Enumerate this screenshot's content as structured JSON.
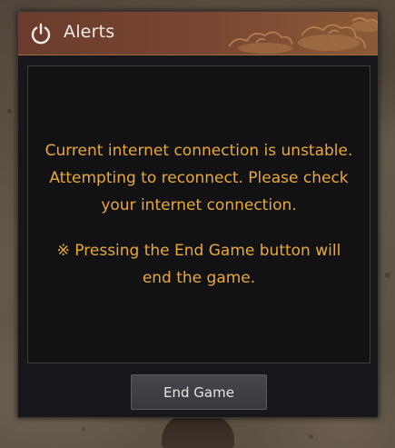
{
  "dialog": {
    "title": "Alerts",
    "title_icon": "power-icon",
    "message_lines": [
      "Current internet connection is unstable.",
      "Attempting to reconnect. Please check",
      "your internet connection."
    ],
    "note_lines": [
      "※ Pressing the End Game button will",
      "end the game."
    ],
    "end_button_label": "End Game"
  },
  "colors": {
    "message_text": "#e8a83a",
    "title_bar": "#7a4732",
    "dialog_background": "#17171b"
  }
}
